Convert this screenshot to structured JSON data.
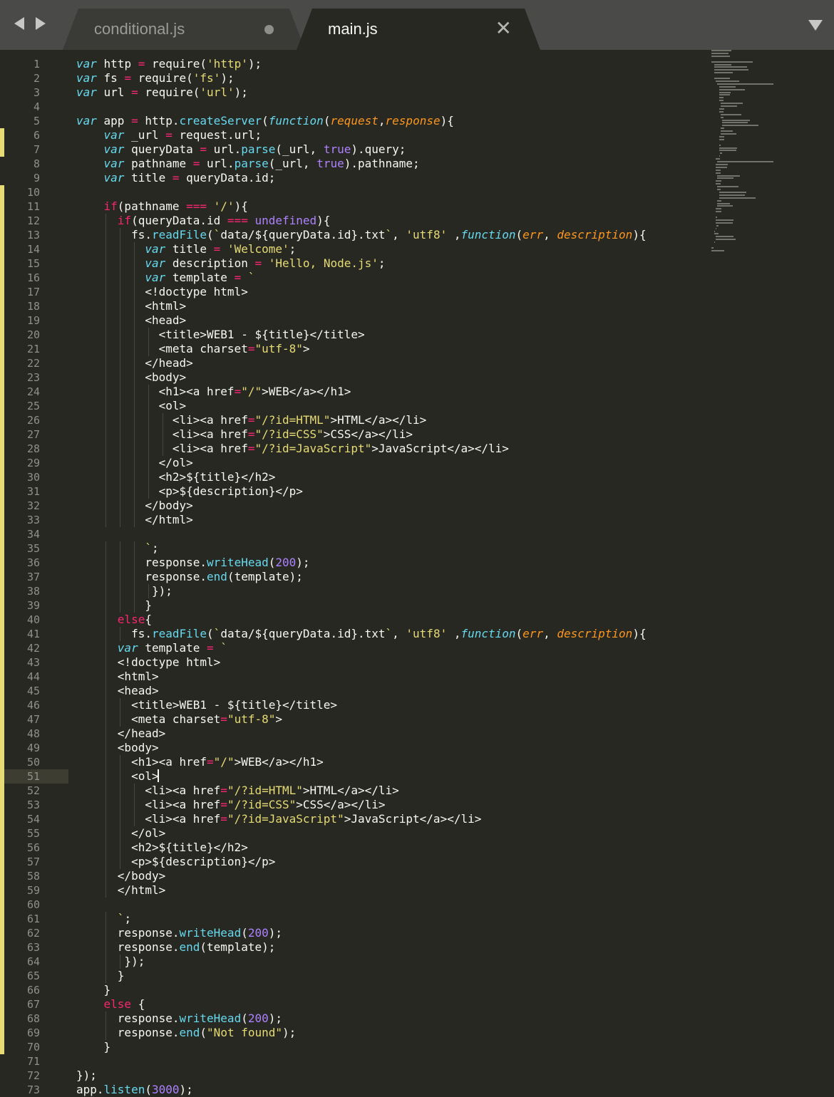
{
  "tabs": [
    {
      "label": "conditional.js",
      "active": false,
      "modified": true
    },
    {
      "label": "main.js",
      "active": true
    }
  ],
  "lines": [
    "var http = require('http');",
    "var fs = require('fs');",
    "var url = require('url');",
    "",
    "var app = http.createServer(function(request,response){",
    "    var _url = request.url;",
    "    var queryData = url.parse(_url, true).query;",
    "    var pathname = url.parse(_url, true).pathname;",
    "    var title = queryData.id;",
    "",
    "    if(pathname === '/'){",
    "      if(queryData.id === undefined){",
    "        fs.readFile(`data/${queryData.id}.txt`, 'utf8' ,function(err, description){",
    "          var title = 'Welcome';",
    "          var description = 'Hello, Node.js';",
    "          var template = `",
    "          <!doctype html>",
    "          <html>",
    "          <head>",
    "            <title>WEB1 - ${title}</title>",
    "            <meta charset=\"utf-8\">",
    "          </head>",
    "          <body>",
    "            <h1><a href=\"/\">WEB</a></h1>",
    "            <ol>",
    "              <li><a href=\"/?id=HTML\">HTML</a></li>",
    "              <li><a href=\"/?id=CSS\">CSS</a></li>",
    "              <li><a href=\"/?id=JavaScript\">JavaScript</a></li>",
    "            </ol>",
    "            <h2>${title}</h2>",
    "            <p>${description}</p>",
    "          </body>",
    "          </html>",
    "",
    "          `;",
    "          response.writeHead(200);",
    "          response.end(template);",
    "           });",
    "          }",
    "      else{",
    "        fs.readFile(`data/${queryData.id}.txt`, 'utf8' ,function(err, description){",
    "      var template = `",
    "      <!doctype html>",
    "      <html>",
    "      <head>",
    "        <title>WEB1 - ${title}</title>",
    "        <meta charset=\"utf-8\">",
    "      </head>",
    "      <body>",
    "        <h1><a href=\"/\">WEB</a></h1>",
    "        <ol>",
    "          <li><a href=\"/?id=HTML\">HTML</a></li>",
    "          <li><a href=\"/?id=CSS\">CSS</a></li>",
    "          <li><a href=\"/?id=JavaScript\">JavaScript</a></li>",
    "        </ol>",
    "        <h2>${title}</h2>",
    "        <p>${description}</p>",
    "      </body>",
    "      </html>",
    "",
    "      `;",
    "      response.writeHead(200);",
    "      response.end(template);",
    "       });",
    "      }",
    "    }",
    "    else {",
    "      response.writeHead(200);",
    "      response.end(\"Not found\");",
    "    }",
    "",
    "});",
    "app.listen(3000);"
  ],
  "current_line": 51,
  "colors": {
    "background": "#272822",
    "tab_bar": "#4a4a48",
    "gutter_modified": "#e6db74"
  }
}
